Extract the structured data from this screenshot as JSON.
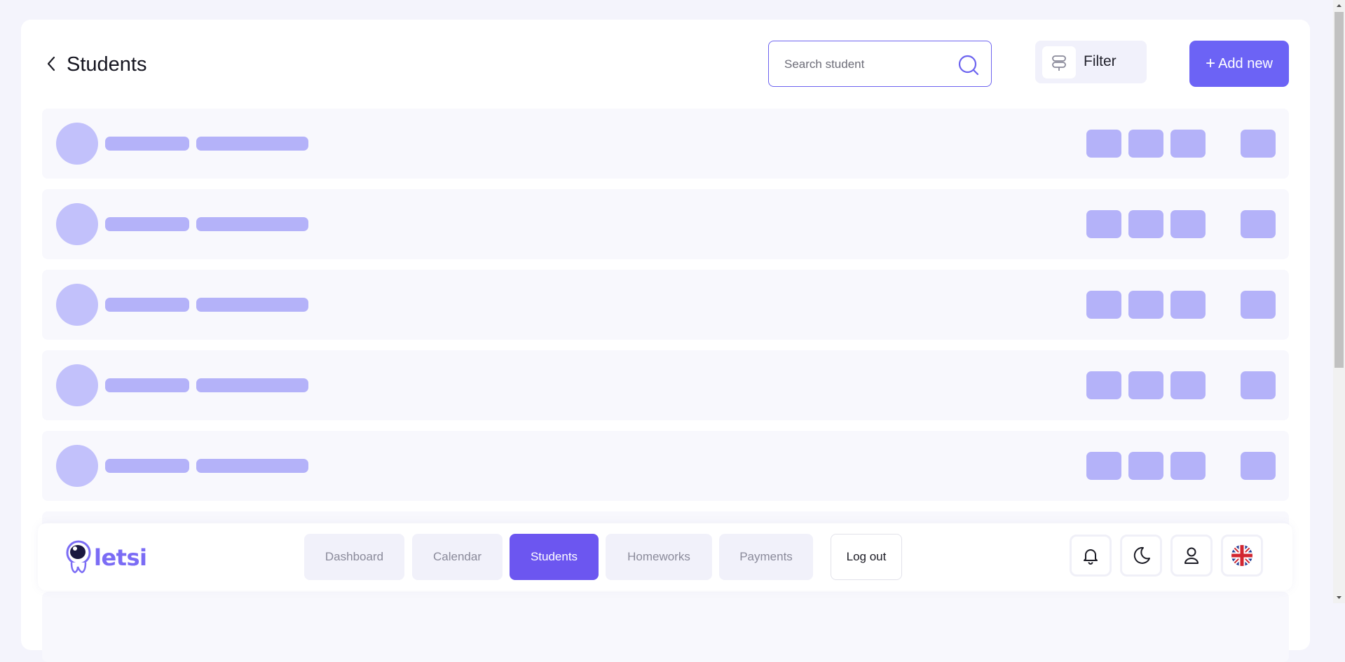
{
  "header": {
    "title": "Students",
    "search_placeholder": "Search student",
    "filter_label": "Filter",
    "add_plus": "+",
    "add_label": "Add new"
  },
  "list": {
    "state": "loading-skeleton",
    "visible_rows": 5
  },
  "bottom_nav": {
    "logo_text": "letsi",
    "tabs": [
      {
        "label": "Dashboard",
        "active": false
      },
      {
        "label": "Calendar",
        "active": false
      },
      {
        "label": "Students",
        "active": true
      },
      {
        "label": "Homeworks",
        "active": false
      },
      {
        "label": "Payments",
        "active": false
      }
    ],
    "logout_label": "Log out",
    "icons": [
      "bell-icon",
      "moon-icon",
      "user-icon",
      "uk-flag-icon"
    ]
  },
  "colors": {
    "accent": "#6c63f5",
    "active_tab": "#6c56f0",
    "skeleton": "#b4b2f9",
    "background": "#f4f4fc"
  }
}
